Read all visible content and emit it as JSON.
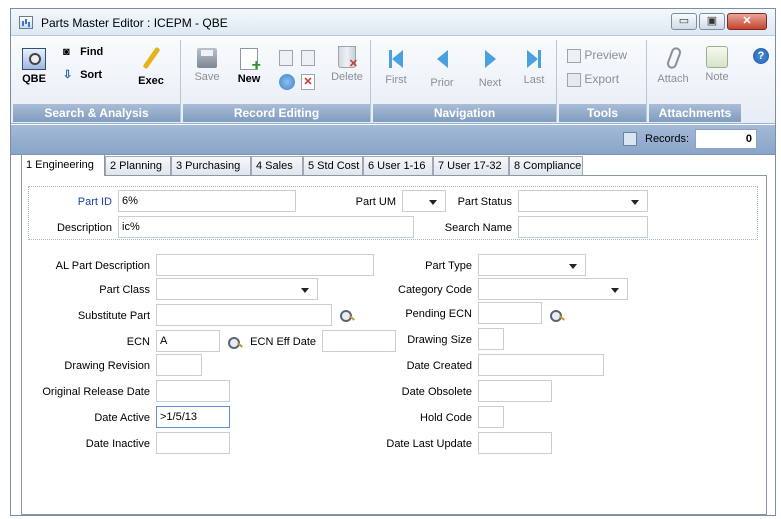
{
  "window": {
    "title": "Parts Master Editor : ICEPM - QBE",
    "min_glyph": "▭",
    "max_glyph": "▣",
    "close_glyph": "✕"
  },
  "ribbon": {
    "groups": [
      {
        "label": "Search & Analysis"
      },
      {
        "label": "Record Editing"
      },
      {
        "label": "Navigation"
      },
      {
        "label": "Tools"
      },
      {
        "label": "Attachments"
      }
    ],
    "buttons": {
      "qbe": "QBE",
      "find": "Find",
      "sort": "Sort",
      "exec": "Exec",
      "save": "Save",
      "new": "New",
      "delete": "Delete",
      "first": "First",
      "prior": "Prior",
      "next": "Next",
      "last": "Last",
      "preview": "Preview",
      "export": "Export",
      "attach": "Attach",
      "note": "Note"
    },
    "help": "?"
  },
  "status": {
    "records_label": "Records:",
    "records_value": "0"
  },
  "tabs": [
    {
      "label": "1 Engineering"
    },
    {
      "label": "2 Planning"
    },
    {
      "label": "3 Purchasing"
    },
    {
      "label": "4 Sales"
    },
    {
      "label": "5 Std Cost"
    },
    {
      "label": "6 User 1-16"
    },
    {
      "label": "7 User 17-32"
    },
    {
      "label": "8 Compliance"
    }
  ],
  "form": {
    "part_id": {
      "label": "Part ID",
      "value": "6%"
    },
    "part_um": {
      "label": "Part UM",
      "value": ""
    },
    "part_status": {
      "label": "Part Status",
      "value": ""
    },
    "description": {
      "label": "Description",
      "value": "ic%"
    },
    "search_name": {
      "label": "Search Name",
      "value": ""
    },
    "al_part_description": {
      "label": "AL Part Description",
      "value": ""
    },
    "part_type": {
      "label": "Part Type",
      "value": ""
    },
    "part_class": {
      "label": "Part Class",
      "value": ""
    },
    "category_code": {
      "label": "Category Code",
      "value": ""
    },
    "substitute_part": {
      "label": "Substitute Part",
      "value": ""
    },
    "pending_ecn": {
      "label": "Pending ECN",
      "value": ""
    },
    "ecn": {
      "label": "ECN",
      "value": "A"
    },
    "ecn_eff_date": {
      "label": "ECN Eff Date",
      "value": ""
    },
    "drawing_size": {
      "label": "Drawing Size",
      "value": ""
    },
    "drawing_revision": {
      "label": "Drawing Revision",
      "value": ""
    },
    "date_created": {
      "label": "Date Created",
      "value": ""
    },
    "original_release_date": {
      "label": "Original Release Date",
      "value": ""
    },
    "date_obsolete": {
      "label": "Date Obsolete",
      "value": ""
    },
    "date_active": {
      "label": "Date Active",
      "value": ">1/5/13"
    },
    "hold_code": {
      "label": "Hold Code",
      "value": ""
    },
    "date_inactive": {
      "label": "Date Inactive",
      "value": ""
    },
    "date_last_update": {
      "label": "Date Last Update",
      "value": ""
    }
  },
  "colors": {
    "ribbon_label_bg": "#8fa9cb",
    "status_bar_bg": "#97afd0",
    "nav_arrow": "#4aa1de",
    "accent_blue": "#1e3fa8"
  }
}
